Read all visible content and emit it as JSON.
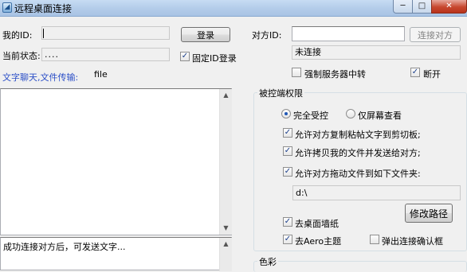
{
  "window": {
    "title": "远程桌面连接",
    "minimize_glyph": "─",
    "maximize_glyph": "□",
    "close_glyph": "✕"
  },
  "local": {
    "my_id_label": "我的ID:",
    "my_id_value": "",
    "login_button": "登录",
    "status_label": "当前状态:",
    "status_value": "....",
    "fixed_id_label": "固定ID登录",
    "fixed_id_checked": true
  },
  "remote": {
    "peer_id_label": "对方ID:",
    "peer_id_value": "",
    "connect_button": "连接对方",
    "connection_status": "未连接",
    "force_relay_label": "强制服务器中转",
    "force_relay_checked": false,
    "disconnect_label": "断开",
    "disconnect_checked": true
  },
  "chat": {
    "header": "文字聊天,文件传输:",
    "file_label": "file",
    "log_text": "",
    "input_text": "成功连接对方后，可发送文字..."
  },
  "permissions": {
    "group_title": "被控端权限",
    "full_control_label": "完全受控",
    "full_control_selected": true,
    "view_only_label": "仅屏幕查看",
    "view_only_selected": false,
    "allow_clipboard_label": "允许对方复制粘帖文字到剪切板;",
    "allow_clipboard_checked": true,
    "allow_copy_files_label": "允许拷贝我的文件并发送给对方;",
    "allow_copy_files_checked": true,
    "allow_drag_files_label": "允许对方拖动文件到如下文件夹:",
    "allow_drag_files_checked": true,
    "folder_path": "d:\\",
    "change_path_button": "修改路径",
    "remove_wallpaper_label": "去桌面墙纸",
    "remove_wallpaper_checked": true,
    "remove_aero_label": "去Aero主题",
    "remove_aero_checked": true,
    "popup_confirm_label": "弹出连接确认框",
    "popup_confirm_checked": false
  },
  "color": {
    "group_title": "色彩"
  },
  "icons": {
    "app": "remote-desktop-icon",
    "check_glyph": "✓",
    "scroll_up_glyph": "▲",
    "scroll_down_glyph": "▼"
  },
  "colors": {
    "accent_blue": "#2b4fc7",
    "close_button": "#c7482f",
    "window_bg": "#f0f0f0"
  }
}
